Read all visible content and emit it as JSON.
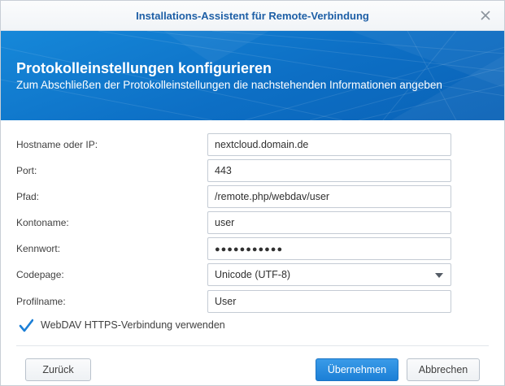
{
  "window": {
    "title": "Installations-Assistent für Remote-Verbindung",
    "close_icon": "close-icon"
  },
  "banner": {
    "heading": "Protokolleinstellungen konfigurieren",
    "subheading": "Zum Abschließen der Protokolleinstellungen die nachstehenden Informationen angeben"
  },
  "form": {
    "hostname": {
      "label": "Hostname oder IP:",
      "value": "nextcloud.domain.de"
    },
    "port": {
      "label": "Port:",
      "value": "443"
    },
    "path": {
      "label": "Pfad:",
      "value": "/remote.php/webdav/user"
    },
    "account": {
      "label": "Kontoname:",
      "value": "user"
    },
    "password": {
      "label": "Kennwort:",
      "value": "●●●●●●●●●●●"
    },
    "codepage": {
      "label": "Codepage:",
      "value": "Unicode (UTF-8)"
    },
    "profile": {
      "label": "Profilname:",
      "value": "User"
    }
  },
  "https_checkbox": {
    "label": "WebDAV HTTPS-Verbindung verwenden",
    "checked": true
  },
  "buttons": {
    "back": "Zurück",
    "apply": "Übernehmen",
    "cancel": "Abbrechen"
  },
  "colors": {
    "accent": "#0d6fc5",
    "title_text": "#1e5fa6",
    "checkbox": "#1c7fd6"
  }
}
